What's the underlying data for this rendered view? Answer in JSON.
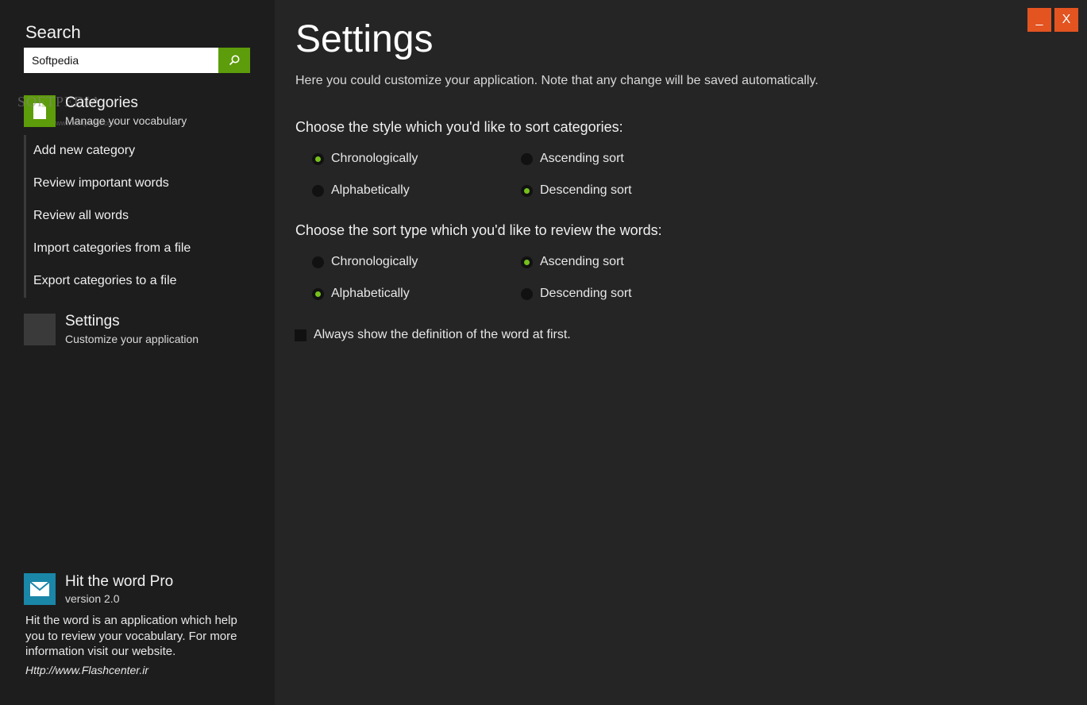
{
  "colors": {
    "accent": "#5d9c0a",
    "radio_selected": "#76c01c",
    "window_button": "#e35420",
    "about_tile": "#1a86a8"
  },
  "sidebar": {
    "search_title": "Search",
    "search_value": "Softpedia",
    "search_icon": "search-icon",
    "watermark": "SOFTPEDIA",
    "watermark_url": "www.softpedia.com",
    "categories": {
      "title": "Categories",
      "subtitle": "Manage your vocabulary",
      "icon": "document-icon"
    },
    "submenu": [
      {
        "label": "Add new category"
      },
      {
        "label": "Review important words"
      },
      {
        "label": "Review all words"
      },
      {
        "label": "Import categories from a file"
      },
      {
        "label": "Export categories to a file"
      }
    ],
    "settings": {
      "title": "Settings",
      "subtitle": "Customize your application"
    },
    "about": {
      "title": "Hit the word Pro",
      "version": "version 2.0",
      "description": "Hit the word is an application which help you to review your vocabulary. For more information visit our website.",
      "link": "Http://www.Flashcenter.ir",
      "icon": "mail-icon"
    }
  },
  "window": {
    "minimize_label": "_",
    "close_label": "X"
  },
  "main": {
    "title": "Settings",
    "description": "Here you could customize your application. Note that any change will be saved automatically.",
    "category_sort": {
      "title": "Choose the style which you'd like to sort categories:",
      "options": [
        {
          "label": "Chronologically",
          "selected": true
        },
        {
          "label": "Alphabetically",
          "selected": false
        },
        {
          "label": "Ascending sort",
          "selected": false
        },
        {
          "label": "Descending sort",
          "selected": true
        }
      ]
    },
    "word_sort": {
      "title": "Choose the sort type which you'd like to review the words:",
      "options": [
        {
          "label": "Chronologically",
          "selected": false
        },
        {
          "label": "Alphabetically",
          "selected": true
        },
        {
          "label": "Ascending sort",
          "selected": true
        },
        {
          "label": "Descending sort",
          "selected": false
        }
      ]
    },
    "definition_checkbox": {
      "label": "Always show the definition of the word at first.",
      "checked": false
    }
  }
}
